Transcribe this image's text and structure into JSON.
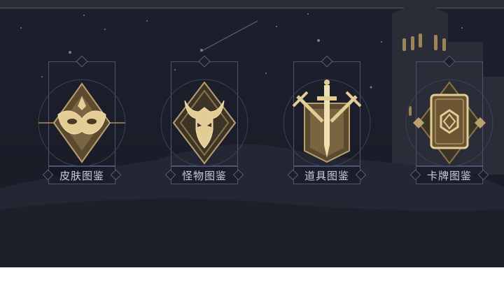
{
  "cards": [
    {
      "label": "皮肤图鉴",
      "icon": "mask-icon"
    },
    {
      "label": "怪物图鉴",
      "icon": "monster-horned-icon"
    },
    {
      "label": "道具图鉴",
      "icon": "crossed-swords-shield-icon"
    },
    {
      "label": "卡牌图鉴",
      "icon": "card-icon"
    }
  ],
  "colors": {
    "gold": "#d9c08a",
    "gold_dark": "#6b5532",
    "frame": "#4a5672",
    "label": "#c9ccd6"
  }
}
